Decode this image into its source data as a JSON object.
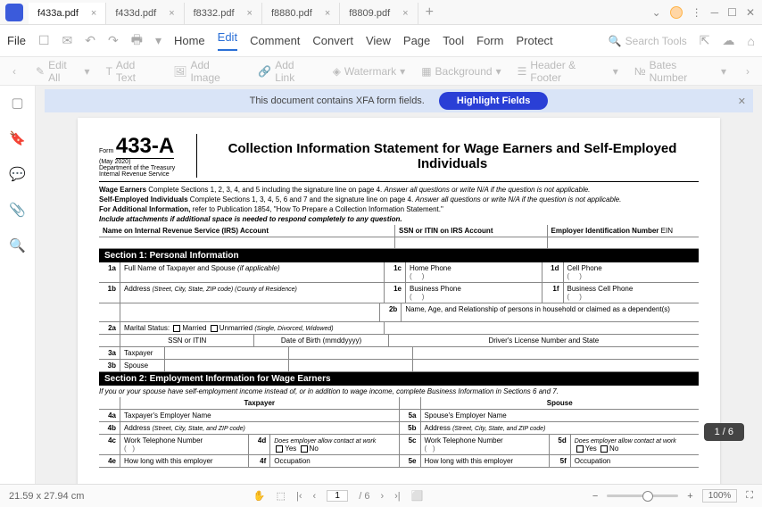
{
  "tabs": [
    {
      "label": "f433a.pdf",
      "active": true
    },
    {
      "label": "f433d.pdf",
      "active": false
    },
    {
      "label": "f8332.pdf",
      "active": false
    },
    {
      "label": "f8880.pdf",
      "active": false
    },
    {
      "label": "f8809.pdf",
      "active": false
    }
  ],
  "menu": {
    "file": "File",
    "items": [
      "Home",
      "Edit",
      "Comment",
      "Convert",
      "View",
      "Page",
      "Tool",
      "Form",
      "Protect"
    ],
    "active_index": 1,
    "search_placeholder": "Search Tools"
  },
  "toolbar": {
    "items": [
      "Edit All",
      "Add Text",
      "Add Image",
      "Add Link",
      "Watermark",
      "Background",
      "Header & Footer",
      "Bates Number"
    ]
  },
  "banner": {
    "text": "This document contains XFA form fields.",
    "button": "Highlight Fields"
  },
  "form": {
    "prefix": "Form",
    "number": "433-A",
    "rev": "(May 2020)",
    "dept": "Department of the Treasury Internal Revenue Service",
    "title": "Collection Information Statement for Wage Earners and Self-Employed Individuals",
    "wage": "Wage Earners",
    "wage_text": " Complete Sections 1, 2, 3, 4, and 5 including the signature line on page 4. ",
    "wage_ital": "Answer all questions or write N/A if the question is not applicable.",
    "self": "Self-Employed Individuals",
    "self_text": " Complete Sections 1, 3, 4, 5, 6 and 7 and the signature line on page 4. ",
    "addl": "For Additional Information,",
    "addl_text": " refer to Publication 1854, \"How To Prepare a Collection Information Statement.\"",
    "attach": "Include attachments if additional space is needed to respond completely to any question.",
    "hdr_name": "Name on Internal Revenue Service (IRS) Account",
    "hdr_ssn": "SSN or ITIN on IRS Account",
    "hdr_ein": "Employer Identification Number",
    "ein_suffix": "EIN",
    "sec1": "Section 1: Personal Information",
    "r1a": "Full Name of Taxpayer and Spouse",
    "r1a_ital": "(if applicable)",
    "r1b": "Address",
    "r1b_ital": "(Street, City, State, ZIP code) (County of Residence)",
    "r1c": "Home Phone",
    "r1d": "Cell Phone",
    "r1e": "Business Phone",
    "r1f": "Business Cell Phone",
    "r2b": "Name, Age, and Relationship of persons in household or claimed as a dependent(s)",
    "r2a": "Marital Status:",
    "married": "Married",
    "unmarried": "Unmarried",
    "unm_ital": "(Single, Divorced, Widowed)",
    "ssn_itin": "SSN or ITIN",
    "dob": "Date of Birth (mmddyyyy)",
    "dln": "Driver's License Number and State",
    "r3a": "Taxpayer",
    "r3b": "Spouse",
    "sec2": "Section 2: Employment Information for Wage Earners",
    "sec2_sub": "If you or your spouse have self-employment income instead of, or in addition to wage income, complete Business Information in Sections 6 and 7.",
    "col_tax": "Taxpayer",
    "col_sp": "Spouse",
    "r4a": "Taxpayer's Employer Name",
    "r5a": "Spouse's Employer Name",
    "r4b": "Address",
    "r4b_ital": "(Street, City, State, and ZIP code)",
    "r4c": "Work Telephone Number",
    "r4d": "Does employer allow contact at work",
    "yes": "Yes",
    "no": "No",
    "r4e": "How long with this employer",
    "r4f": "Occupation"
  },
  "status": {
    "dims": "21.59 x 27.94 cm",
    "page": "1",
    "total": "/ 6",
    "zoom": "100%"
  },
  "page_badge": "1 / 6"
}
